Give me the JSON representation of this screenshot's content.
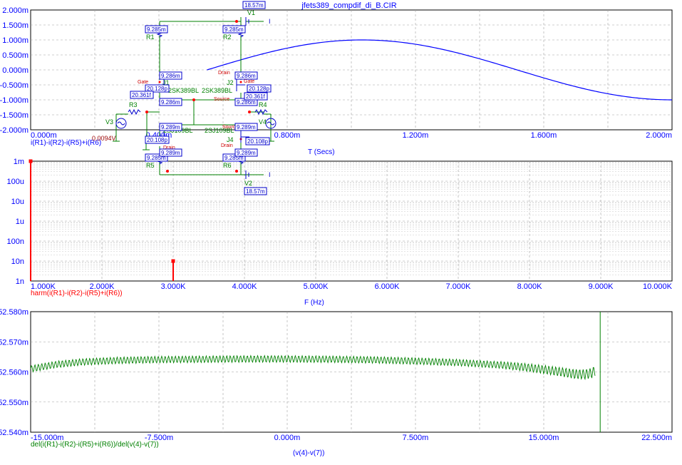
{
  "file_title": "jfets389_compdif_di_B.CIR",
  "colors": {
    "axis_text": "#0000ff",
    "transient": "#0000ff",
    "harmonic": "#ff0000",
    "sweep": "#008000",
    "circuit_wire": "#008000",
    "circuit_label": "#008000",
    "circuit_probe": "#0000cc",
    "circuit_part": "#0000cc",
    "node_dot": "#ff0000",
    "grid": "#a0a0a0"
  },
  "chart_data": [
    {
      "type": "line",
      "series": [
        {
          "name": "i(R1)-i(R2)-i(R5)+i(R6)",
          "start_x": 0.00055,
          "x_unit": "s",
          "frequency_hz": 3000,
          "amplitude": 0.001
        }
      ],
      "xlabel": "T (Secs)",
      "x_ticks": [
        "0.000m",
        "0.400m",
        "0.800m",
        "1.200m",
        "1.600m",
        "2.000m"
      ],
      "y_ticks": [
        "2.000m",
        "1.500m",
        "1.000m",
        "0.500m",
        "0.000m",
        "-0.500m",
        "-1.000m",
        "-1.500m",
        "-2.000m"
      ],
      "xlim": [
        0,
        0.002
      ],
      "ylim": [
        -0.002,
        0.002
      ],
      "grid": true
    },
    {
      "type": "bar",
      "series": [
        {
          "name": "harm(i(R1)-i(R2)-i(R5)+i(R6))",
          "points": [
            [
              1000,
              0.001
            ],
            [
              3000,
              1e-08
            ]
          ]
        }
      ],
      "xlabel": "F (Hz)",
      "x_ticks": [
        "1.000K",
        "2.000K",
        "3.000K",
        "4.000K",
        "5.000K",
        "6.000K",
        "7.000K",
        "8.000K",
        "9.000K",
        "10.000K"
      ],
      "y_ticks": [
        "1m",
        "100u",
        "10u",
        "1u",
        "100n",
        "10n",
        "1n"
      ],
      "xlim": [
        1000,
        10000
      ],
      "ylim": [
        1e-09,
        0.001
      ],
      "y_scale": "log",
      "grid": true
    },
    {
      "type": "line",
      "series": [
        {
          "name": "del(i(R1)-i(R2)-i(R5)+i(R6))/del(v(4)-v(7))",
          "x": [
            -0.015,
            -0.0135,
            -0.012,
            -0.01,
            -0.0075,
            -0.005,
            -0.0025,
            0,
            0.0025,
            0.005,
            0.0075,
            0.01,
            0.0125,
            0.014,
            0.015,
            0.016,
            0.0168,
            0.0174,
            0.0178,
            0.018
          ],
          "y": [
            52.561,
            52.5625,
            52.5633,
            52.5638,
            52.5641,
            52.5642,
            52.5643,
            52.5643,
            52.5642,
            52.564,
            52.5636,
            52.5631,
            52.5623,
            52.5615,
            52.5608,
            52.56,
            52.5593,
            52.5592,
            52.5596,
            52.5604
          ]
        }
      ],
      "xlabel": "(v(4)-v(7))",
      "x_ticks": [
        "-15.000m",
        "-7.500m",
        "0.000m",
        "7.500m",
        "15.000m",
        "22.500m"
      ],
      "y_ticks": [
        "52.580m",
        "52.570m",
        "52.560m",
        "52.550m",
        "52.540m"
      ],
      "xlim": [
        -0.015,
        0.0225
      ],
      "ylim": [
        52.54,
        52.58
      ],
      "grid": true
    }
  ],
  "circuit": {
    "parts": {
      "V1": "V1",
      "V2": "V2",
      "V3": "V3",
      "V4": "V4",
      "R1": "R1",
      "R2": "R2",
      "R3": "R3",
      "R4": "R4",
      "R5": "R5",
      "R6": "R6",
      "J1": "J1",
      "J2": "J2",
      "J4": "J4",
      "J1_model": "2SK389BL",
      "J2_model": "2SK389BL",
      "J3_model": "2SJ109BL",
      "J4_model": "2SJ109BL"
    },
    "pins": {
      "gate": "Gate",
      "drain": "Drain",
      "source": "Source"
    },
    "probes": {
      "p1": "18.57m",
      "p2": "18.57m",
      "r1": "9.285m",
      "r2": "9.285m",
      "r5": "9.285m",
      "r6": "9.285m",
      "j1d": "9.286m",
      "j1s": "9.286m",
      "j2d": "9.286m",
      "j2s": "9.286m",
      "j3d": "9.289m",
      "j3s": "9.289m",
      "j4d": "9.289m",
      "j4s": "9.289m",
      "c1": "20.128p",
      "c2": "20.128p",
      "c3": "20.108p",
      "c4": "20.108p",
      "c5": "20.361f",
      "c6": "20.361f"
    },
    "node_voltage": "0.0094V",
    "battery_mark": "I"
  }
}
